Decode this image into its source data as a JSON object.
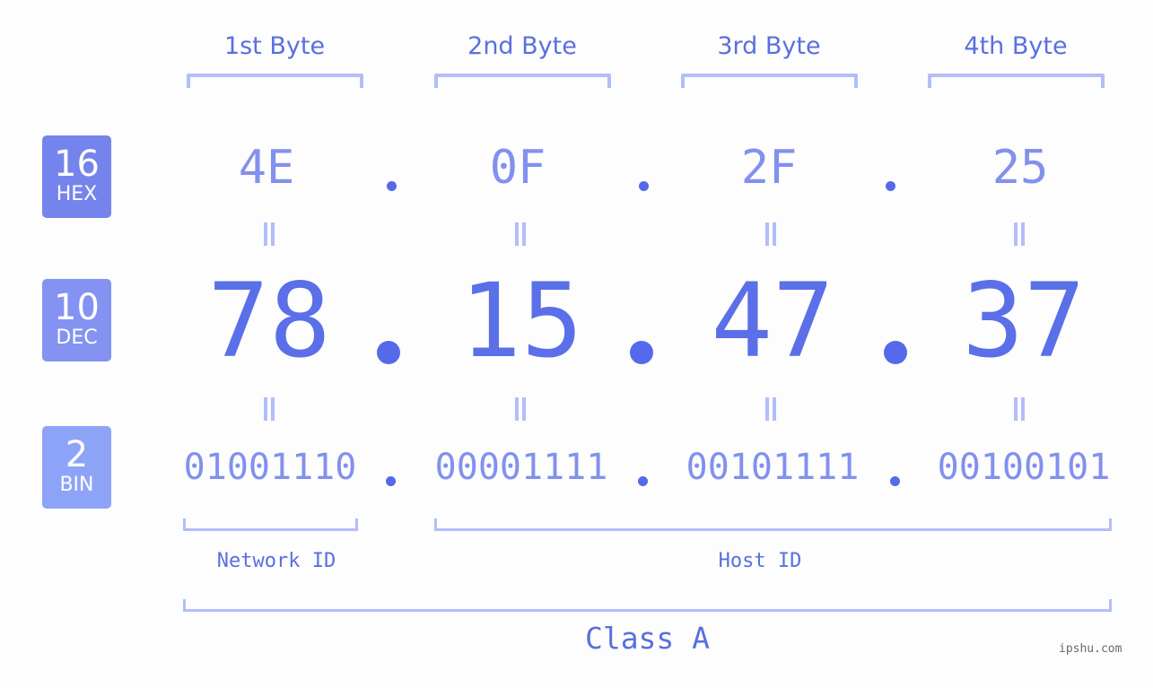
{
  "bytes": {
    "headers": [
      "1st Byte",
      "2nd Byte",
      "3rd Byte",
      "4th Byte"
    ]
  },
  "bases": {
    "hex": {
      "number": "16",
      "label": "HEX"
    },
    "dec": {
      "number": "10",
      "label": "DEC"
    },
    "bin": {
      "number": "2",
      "label": "BIN"
    }
  },
  "ip": {
    "hex": [
      "4E",
      "0F",
      "2F",
      "25"
    ],
    "dec": [
      "78",
      "15",
      "47",
      "37"
    ],
    "bin": [
      "01001110",
      "00001111",
      "00101111",
      "00100101"
    ]
  },
  "segments": {
    "network_id": "Network ID",
    "host_id": "Host ID",
    "ip_class": "Class A"
  },
  "colors": {
    "accent": "#5a6fe8",
    "light_accent": "#8290ee",
    "bracket": "#b3bdfa",
    "hex_badge": "#7584ec",
    "dec_badge": "#8492f2",
    "bin_badge": "#8da3f8"
  },
  "watermark": "ipshu.com"
}
